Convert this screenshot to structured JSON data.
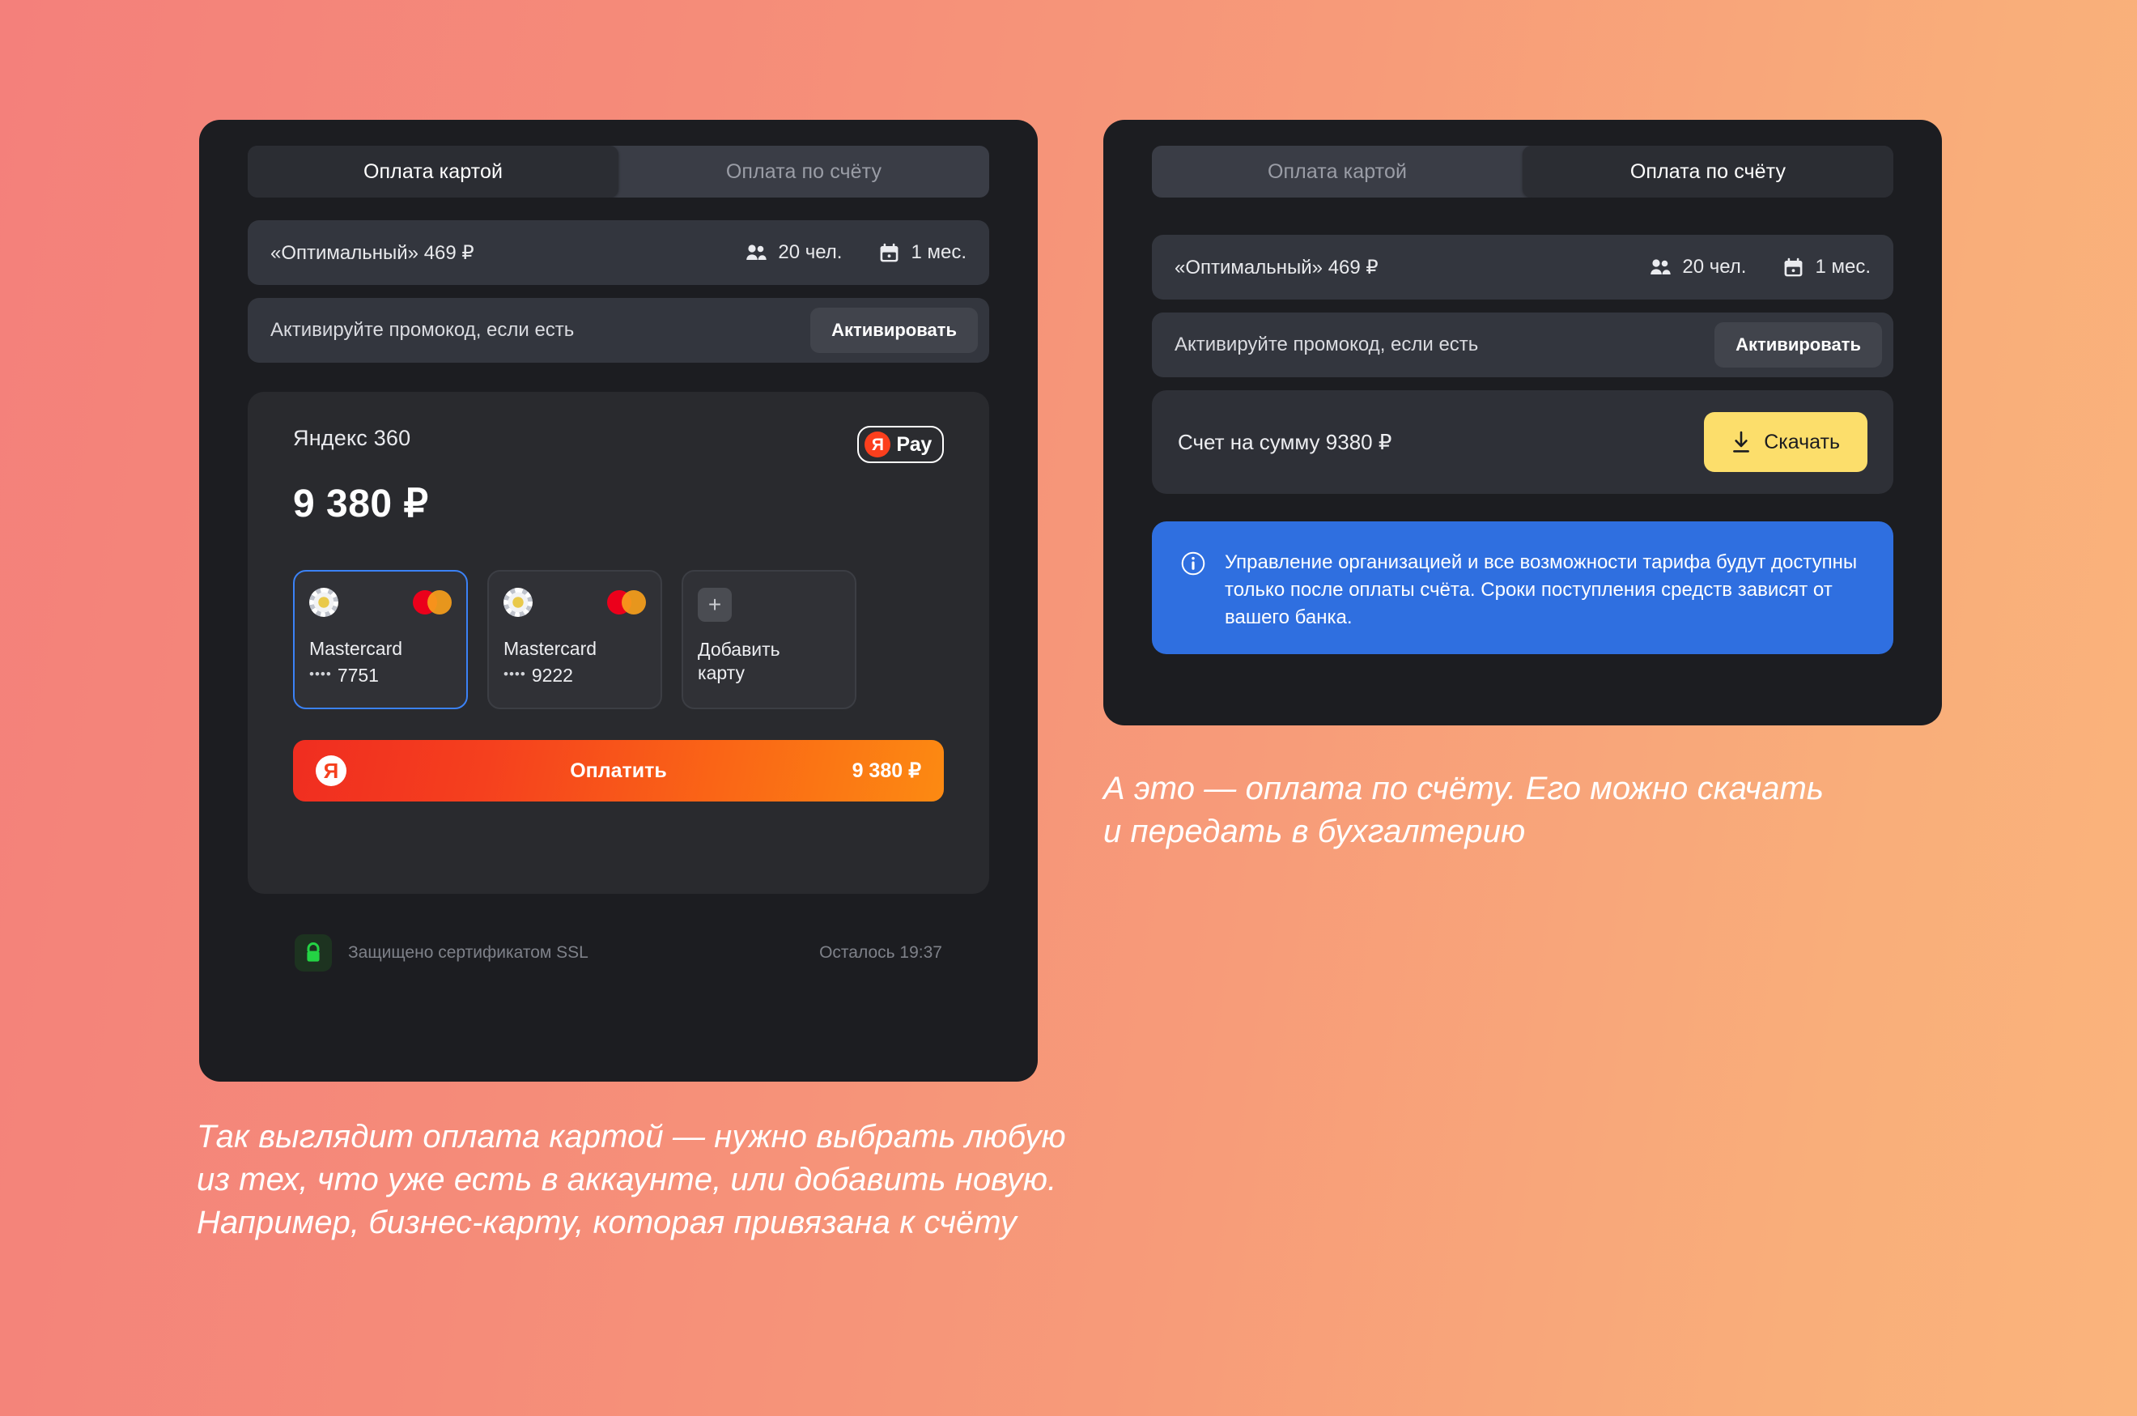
{
  "background": {
    "from": "#F4807B",
    "to": "#FAB47C"
  },
  "panels": {
    "card_payment": {
      "tabs": [
        {
          "label": "Оплата картой",
          "active": true
        },
        {
          "label": "Оплата по счёту",
          "active": false
        }
      ],
      "plan": {
        "name": "«Оптимальный» 469 ₽",
        "people": "20 чел.",
        "period": "1 мес."
      },
      "promo": {
        "label": "Активируйте промокод, если есть",
        "button": "Активировать"
      },
      "pay_card": {
        "merchant": "Яндекс 360",
        "badge_logo": "Я",
        "badge_text": "Pay",
        "amount": "9 380 ₽",
        "cards": [
          {
            "brand": "Mastercard",
            "dots": "••••",
            "last4": "7751",
            "selected": true
          },
          {
            "brand": "Mastercard",
            "dots": "••••",
            "last4": "9222",
            "selected": false
          }
        ],
        "add_card": {
          "plus": "+",
          "label": "Добавить\nкарту"
        },
        "pay_button": {
          "logo": "Я",
          "label": "Оплатить",
          "amount": "9 380 ₽"
        }
      },
      "footer": {
        "ssl": "Защищено сертификатом SSL",
        "timer": "Осталось 19:37"
      }
    },
    "invoice_payment": {
      "tabs": [
        {
          "label": "Оплата картой",
          "active": false
        },
        {
          "label": "Оплата по счёту",
          "active": true
        }
      ],
      "plan": {
        "name": "«Оптимальный» 469 ₽",
        "people": "20 чел.",
        "period": "1 мес."
      },
      "promo": {
        "label": "Активируйте промокод, если есть",
        "button": "Активировать"
      },
      "invoice": {
        "label": "Счет на сумму 9380 ₽",
        "download_button": "Скачать"
      },
      "info_banner": {
        "text": "Управление организацией и все возможности тарифа будут доступны только после оплаты счёта. Сроки поступления средств зависят от вашего банка.",
        "color": "#2F6FE0"
      }
    }
  },
  "captions": {
    "left": "Так выглядит оплата картой — нужно выбрать любую из тех, что уже есть в аккаунте, или добавить новую. Например, бизнес-карту, которая привязана к счёту",
    "right": "А это — оплата по счёту. Его можно скачать и передать в бухгалтерию"
  }
}
